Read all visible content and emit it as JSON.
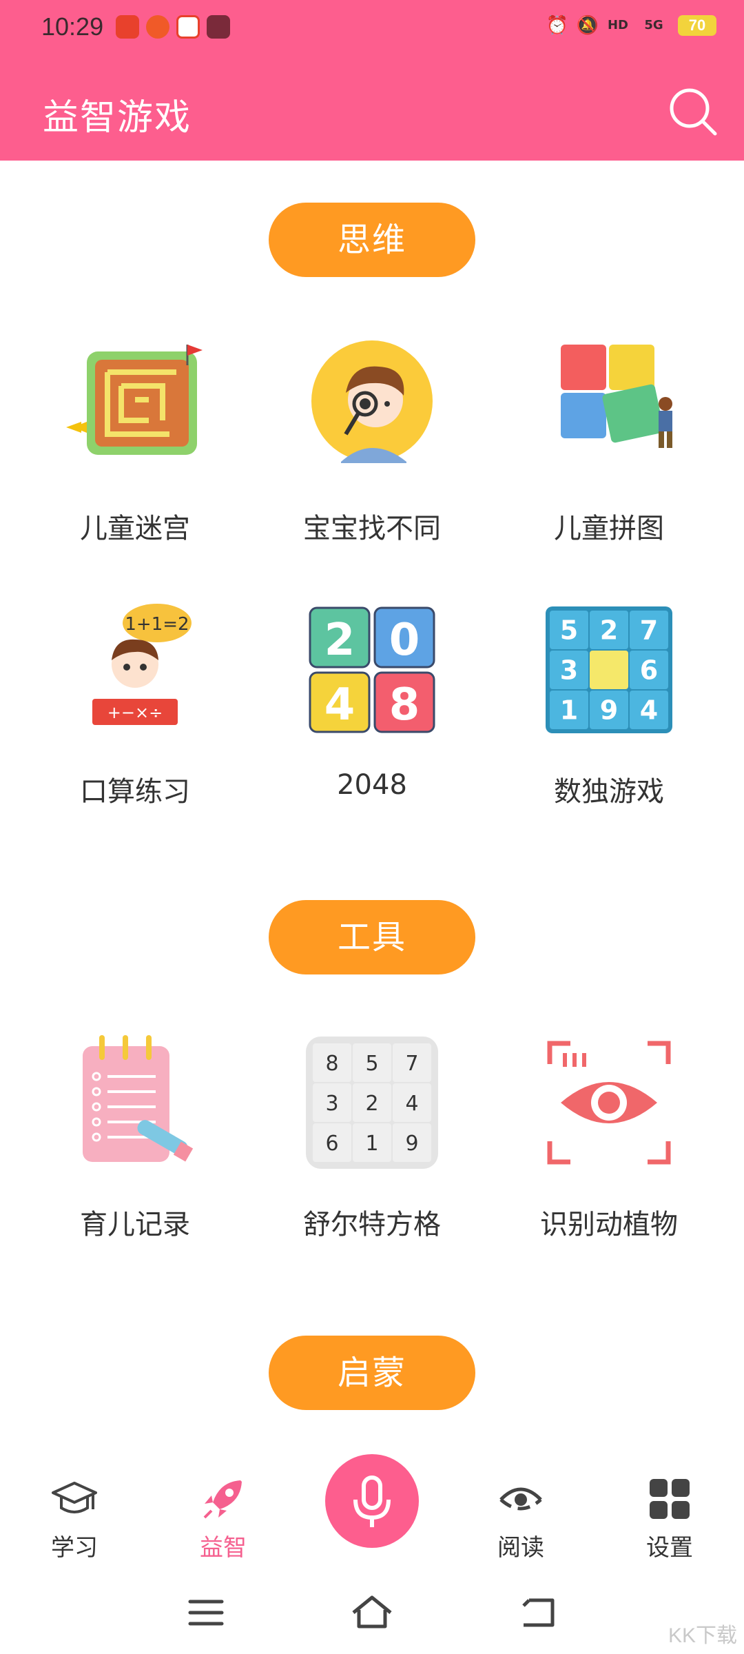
{
  "status_bar": {
    "time": "10:29",
    "battery": "70",
    "network": "5G"
  },
  "header": {
    "title": "益智游戏"
  },
  "sections": [
    {
      "title": "思维",
      "items": [
        {
          "label": "儿童迷宫",
          "icon": "maze-icon"
        },
        {
          "label": "宝宝找不同",
          "icon": "boy-magnifier-icon"
        },
        {
          "label": "儿童拼图",
          "icon": "puzzle-icon"
        },
        {
          "label": "口算练习",
          "icon": "mental-math-icon"
        },
        {
          "label": "2048",
          "icon": "game-2048-icon"
        },
        {
          "label": "数独游戏",
          "icon": "sudoku-icon"
        }
      ]
    },
    {
      "title": "工具",
      "items": [
        {
          "label": "育儿记录",
          "icon": "notebook-icon"
        },
        {
          "label": "舒尔特方格",
          "icon": "schulte-grid-icon"
        },
        {
          "label": "识别动植物",
          "icon": "eye-scan-icon"
        }
      ]
    },
    {
      "title": "启蒙",
      "items": []
    }
  ],
  "icon_text": {
    "math_bubble": "1+1=2",
    "math_sign": "+−×÷",
    "tiles_2048": [
      "2",
      "0",
      "4",
      "8"
    ],
    "sudoku": [
      "5",
      "2",
      "7",
      "3",
      "",
      "6",
      "1",
      "9",
      "4"
    ],
    "schulte": [
      "8",
      "5",
      "7",
      "3",
      "2",
      "4",
      "6",
      "1",
      "9"
    ]
  },
  "bottom_nav": [
    {
      "label": "学习",
      "icon": "graduation-cap-icon",
      "active": false
    },
    {
      "label": "益智",
      "icon": "rocket-icon",
      "active": true
    },
    {
      "label": "阅读",
      "icon": "eye-read-icon",
      "active": false
    },
    {
      "label": "设置",
      "icon": "grid-settings-icon",
      "active": false
    }
  ],
  "watermark": "KK下载",
  "colors": {
    "header": "#FD5E8E",
    "pill": "#FF9A22",
    "active": "#F5608F"
  }
}
